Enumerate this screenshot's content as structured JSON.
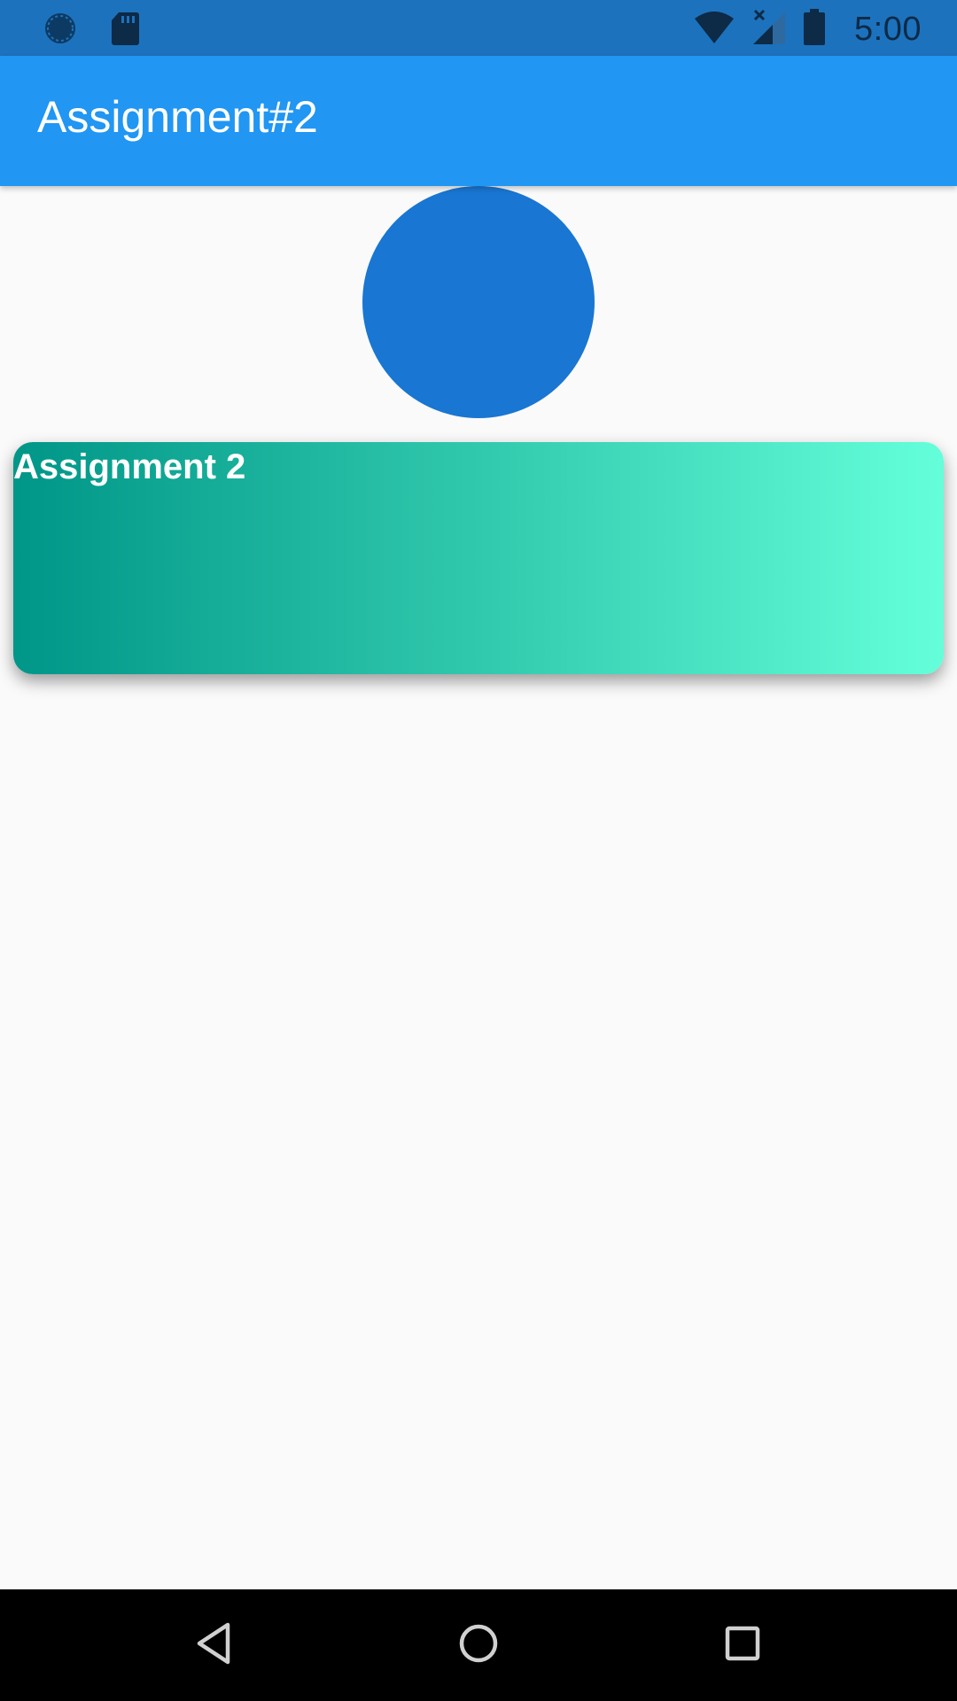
{
  "status_bar": {
    "time": "5:00",
    "icons": [
      "sync-icon",
      "sd-card-icon",
      "wifi-icon",
      "cell-signal-icon",
      "battery-icon"
    ]
  },
  "app_bar": {
    "title": "Assignment#2",
    "color": "#2196f3"
  },
  "circle": {
    "color": "#1976d2"
  },
  "card": {
    "title": "Assignment 2",
    "gradient": [
      "#009688",
      "#64ffda"
    ]
  },
  "nav_bar": {
    "icons": [
      "back-icon",
      "home-icon",
      "recents-icon"
    ]
  }
}
